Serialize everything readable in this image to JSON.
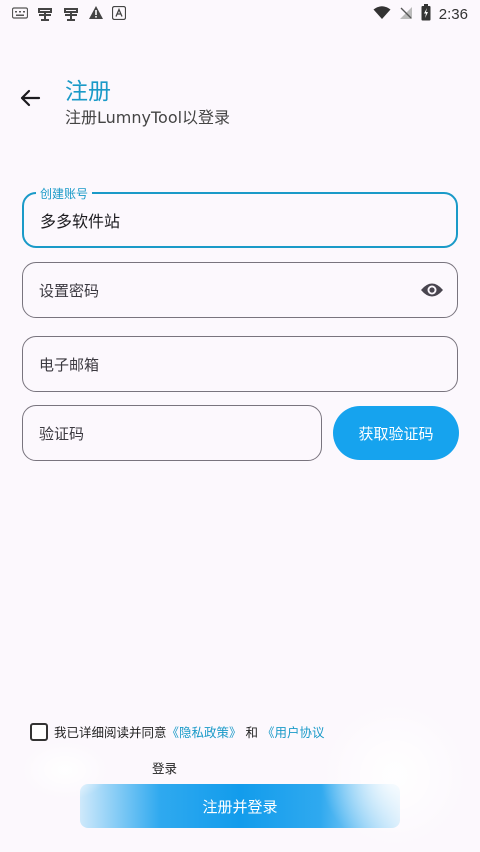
{
  "status_bar": {
    "time": "2:36",
    "left_icons": [
      "keyboard-icon",
      "debug-icon",
      "debug-icon",
      "warning-icon",
      "app-icon"
    ],
    "right_icons": [
      "wifi-icon",
      "no-sim-icon",
      "battery-icon"
    ]
  },
  "header": {
    "title": "注册",
    "subtitle": "注册LumnyTool以登录"
  },
  "form": {
    "account": {
      "label": "创建账号",
      "value": "多多软件站"
    },
    "password": {
      "placeholder": "设置密码"
    },
    "email": {
      "placeholder": "电子邮箱"
    },
    "code": {
      "placeholder": "验证码",
      "button": "获取验证码"
    }
  },
  "agreement": {
    "prefix": "我已详细阅读并同意",
    "privacy": "《隐私政策》",
    "and": "和",
    "terms": "《用户协议",
    "suffix": "登录"
  },
  "submit": {
    "label": "注册并登录"
  },
  "colors": {
    "accent": "#1a9ac8",
    "button": "#16a3ee",
    "background": "#fcf8fd"
  }
}
